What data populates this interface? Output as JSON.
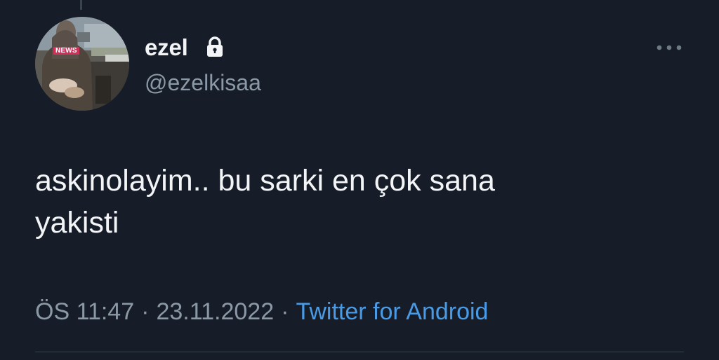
{
  "tweet": {
    "display_name": "ezel",
    "handle": "@ezelkisaa",
    "avatar_badge": "NEWS",
    "text": "askinolayim.. bu sarki en çok sana\nyakisti",
    "time": "ÖS 11:47",
    "date": "23.11.2022",
    "separator": "·",
    "source": "Twitter for Android"
  },
  "icons": {
    "lock": "lock-icon",
    "more": "more-horizontal-icon"
  },
  "colors": {
    "background": "#161d29",
    "primary_text": "#f2f4f6",
    "secondary_text": "#8b98a5",
    "link": "#4a9be6"
  }
}
